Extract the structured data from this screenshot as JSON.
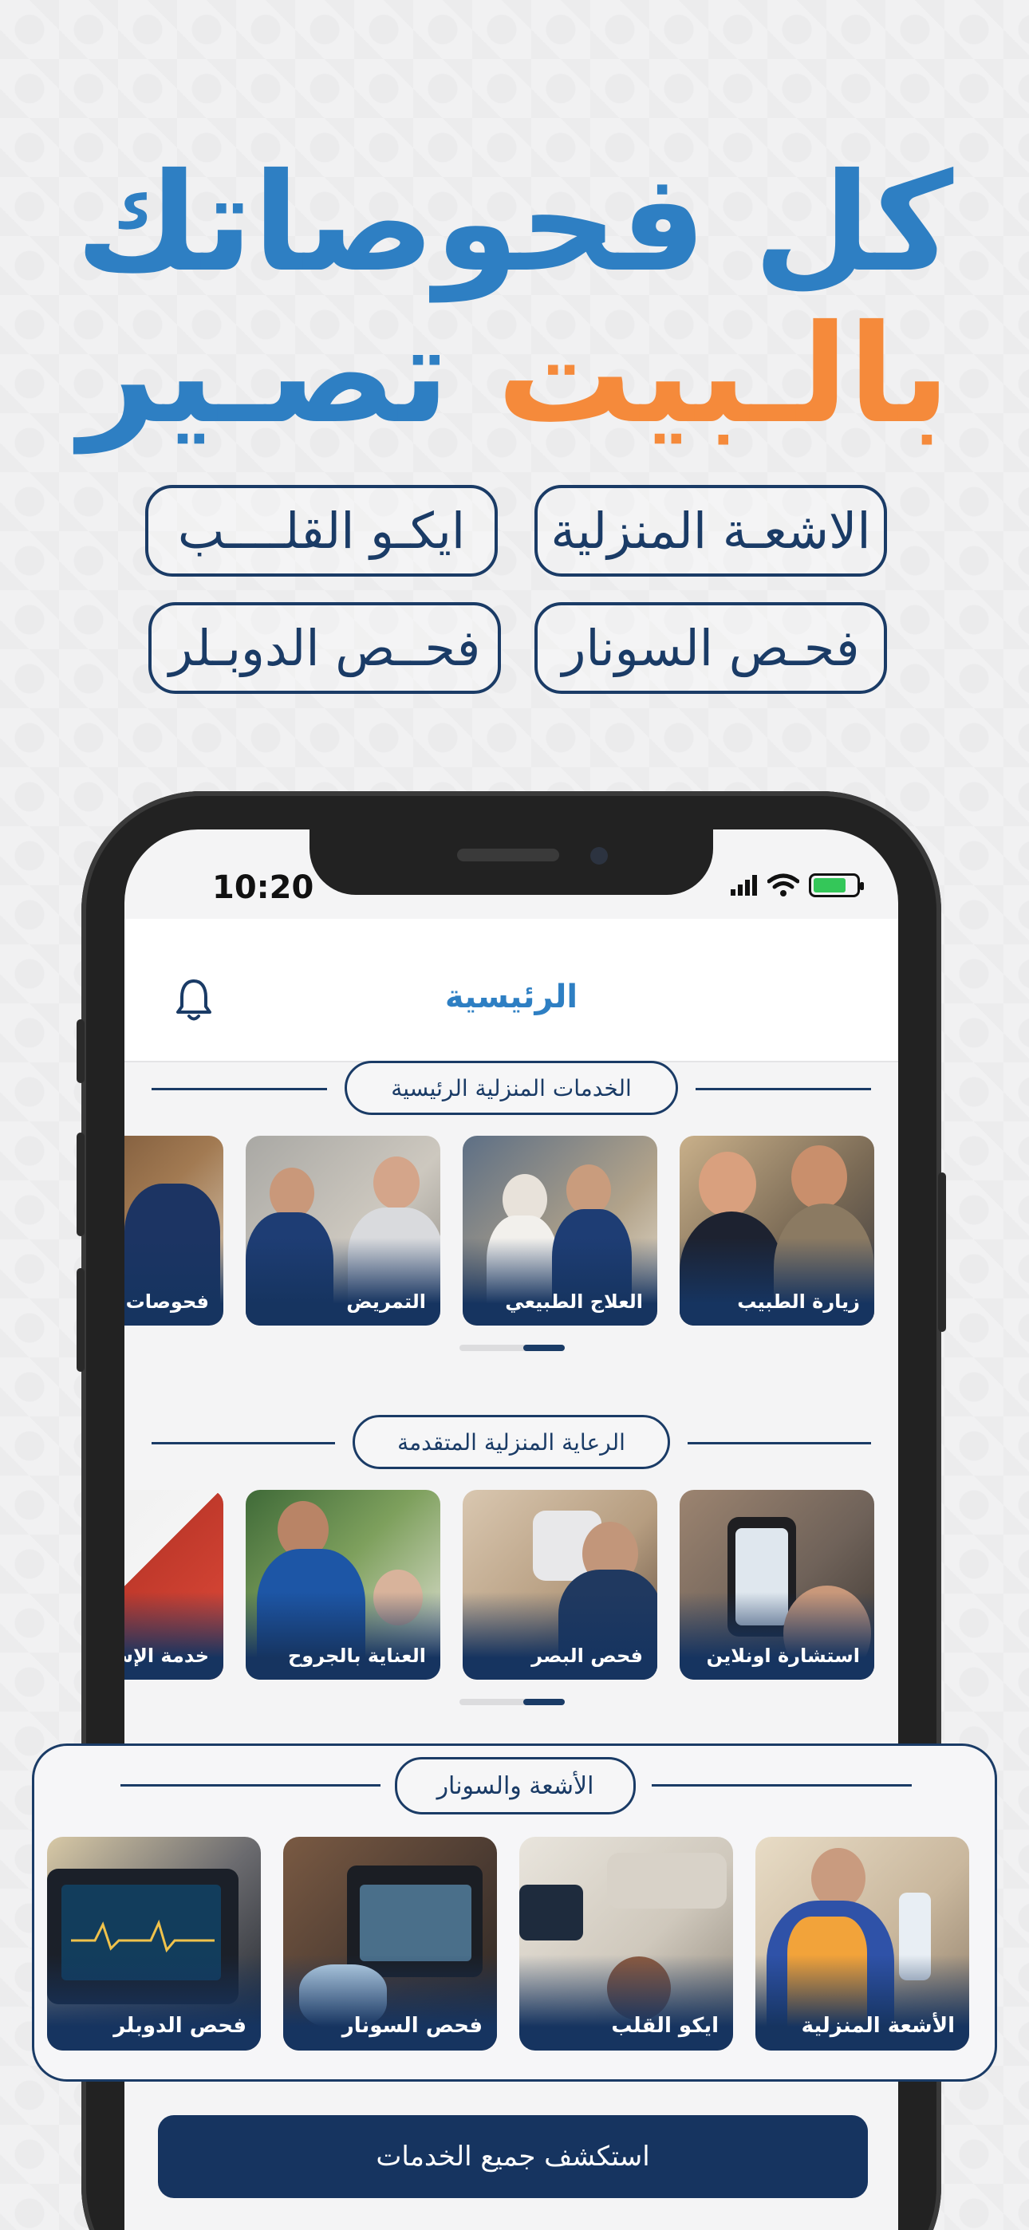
{
  "headline": {
    "line1": "كل فحوصاتك",
    "line2_part1": "تصـير",
    "line2_part2": "بالـبيت"
  },
  "tags": [
    {
      "id": "home-xray",
      "label": "الاشعـة المنزلية"
    },
    {
      "id": "echo",
      "label": "ايكـو القلــــب"
    },
    {
      "id": "sonar",
      "label": "فحـص السونار"
    },
    {
      "id": "doppler",
      "label": "فحــص الدوبـلر"
    }
  ],
  "status_bar": {
    "time": "10:20"
  },
  "app": {
    "title": "الرئيسية",
    "sections": {
      "main": {
        "title": "الخدمات المنزلية الرئيسية",
        "cards": [
          "زيارة الطبيب",
          "العلاج الطبيعي",
          "التمريض",
          "فحوصات"
        ]
      },
      "advanced": {
        "title": "الرعاية المنزلية المتقدمة",
        "cards": [
          "استشارة اونلاين",
          "فحص البصر",
          "العناية بالجروح",
          "خدمة الإس"
        ]
      },
      "imaging": {
        "title": "الأشعة والسونار",
        "cards": [
          "الأشعة المنزلية",
          "ايكو القلب",
          "فحص السونار",
          "فحص الدوبلر"
        ]
      }
    },
    "cta_label": "استكشف جميع الخدمات"
  },
  "colors": {
    "primary_blue": "#2e7fc3",
    "accent_orange": "#f58a3b",
    "navy": "#1a3b66",
    "card_overlay": "#163460"
  }
}
